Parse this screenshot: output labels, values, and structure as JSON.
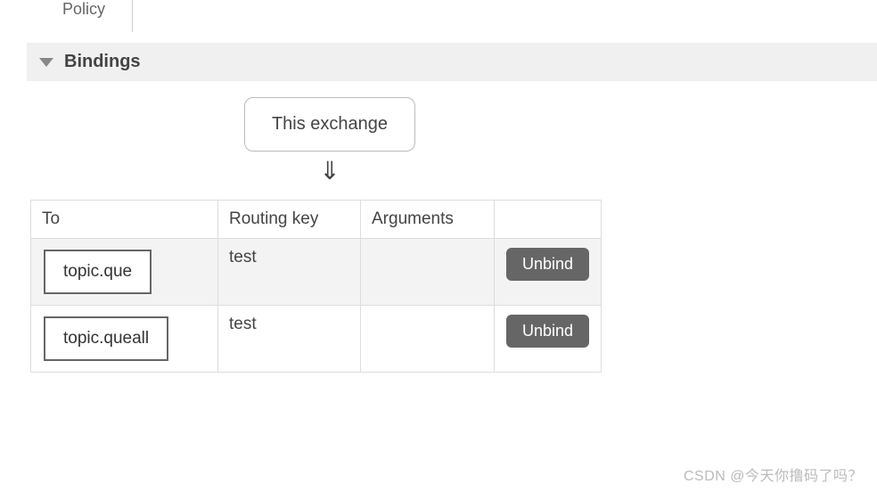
{
  "tab_fragment": "Policy",
  "section": {
    "title": "Bindings",
    "exchange_label": "This exchange",
    "arrow_glyph": "⇓"
  },
  "table": {
    "headers": {
      "to": "To",
      "routing_key": "Routing key",
      "arguments": "Arguments"
    },
    "rows": [
      {
        "to": "topic.que",
        "routing_key": "test",
        "arguments": "",
        "action": "Unbind",
        "selected": true
      },
      {
        "to": "topic.queall",
        "routing_key": "test",
        "arguments": "",
        "action": "Unbind",
        "selected": false
      }
    ]
  },
  "watermark": "CSDN @今天你撸码了吗？"
}
